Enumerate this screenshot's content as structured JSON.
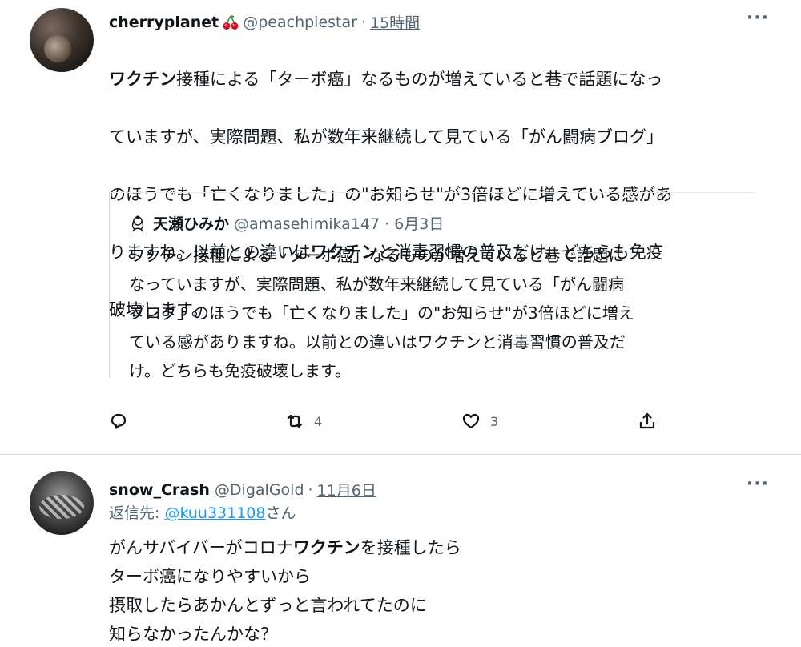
{
  "tweet1": {
    "display_name": "cherryplanet",
    "name_emoji": "cherries-emoji",
    "handle": "@peachpiestar",
    "separator": "·",
    "time": "15時間",
    "more": "···",
    "text_lines": [
      "ワクチン接種による「ターボ癌」なるものが増えていると巷で話題になっ",
      "ていますが、実際問題、私が数年来継続して見ている「がん闘病ブログ」",
      "のほうでも「亡くなりました」の\"お知らせ\"が3倍ほどに増えている感があ",
      "りますね。以前との違いはワクチンと消毒習慣の普及だけ。どちらも免疫",
      "破壊します。"
    ],
    "quote": {
      "name": "天瀬ひみか",
      "handle": "@amasehimika147 · 6月3日",
      "text": "ワクチン接種による「ターボ癌」なるものが増えていると巷で話題に\nなっていますが、実際問題、私が数年来継続して見ている「がん闘病\nブログ」のほうでも「亡くなりました」の\"お知らせ\"が3倍ほどに増え\nている感がありますね。以前との違いはワクチンと消毒習慣の普及だ\nけ。どちらも免疫破壊します。"
    },
    "actions": {
      "reply_count": "",
      "retweet_count": "4",
      "like_count": "3"
    }
  },
  "tweet2": {
    "display_name": "snow_Crash",
    "handle": "@DigalGold",
    "separator": "·",
    "time": "11月6日",
    "more": "···",
    "reply_prefix": "返信先: ",
    "reply_handle": "@kuu331108",
    "reply_suffix": "さん",
    "text": "がんサバイバーがコロナワクチンを接種したら\nターボ癌になりやすいから\n摂取したらあかんとずっと言われてたのに\n知らなかったんかな？"
  },
  "colors": {
    "text": "#0f1419",
    "secondary": "#536471",
    "link": "#1d9bf0",
    "divider": "#cfd9de"
  }
}
